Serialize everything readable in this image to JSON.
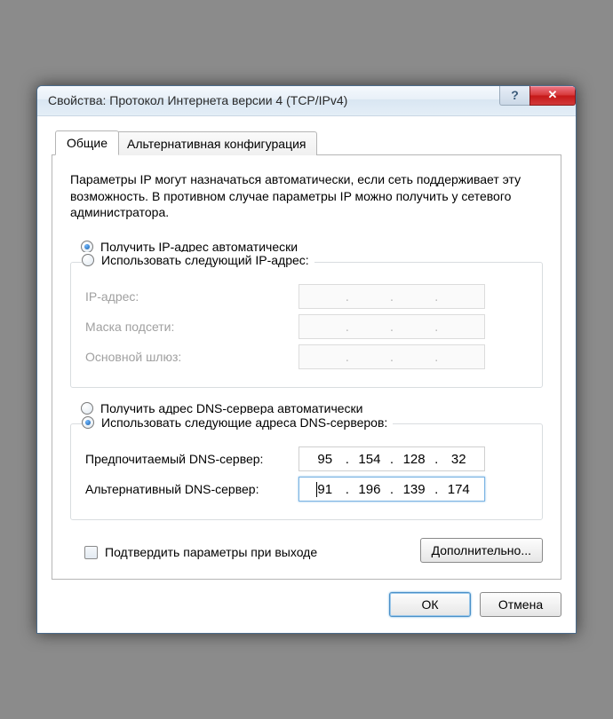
{
  "titlebar": {
    "title": "Свойства: Протокол Интернета версии 4 (TCP/IPv4)",
    "help_glyph": "?",
    "close_glyph": "✕"
  },
  "tabs": {
    "general": "Общие",
    "alternate": "Альтернативная конфигурация"
  },
  "intro": "Параметры IP могут назначаться автоматически, если сеть поддерживает эту возможность. В противном случае параметры IP можно получить у сетевого администратора.",
  "ip_section": {
    "auto_label": "Получить IP-адрес автоматически",
    "manual_label": "Использовать следующий IP-адрес:",
    "ip_label": "IP-адрес:",
    "mask_label": "Маска подсети:",
    "gateway_label": "Основной шлюз:",
    "ip_value": [
      "",
      "",
      "",
      ""
    ],
    "mask_value": [
      "",
      "",
      "",
      ""
    ],
    "gateway_value": [
      "",
      "",
      "",
      ""
    ],
    "selected": "auto"
  },
  "dns_section": {
    "auto_label": "Получить адрес DNS-сервера автоматически",
    "manual_label": "Использовать следующие адреса DNS-серверов:",
    "preferred_label": "Предпочитаемый DNS-сервер:",
    "alternate_label": "Альтернативный DNS-сервер:",
    "preferred_value": [
      "95",
      "154",
      "128",
      "32"
    ],
    "alternate_value": [
      "91",
      "196",
      "139",
      "174"
    ],
    "selected": "manual"
  },
  "validate_checkbox": {
    "label": "Подтвердить параметры при выходе",
    "checked": false
  },
  "buttons": {
    "advanced": "Дополнительно...",
    "ok": "ОК",
    "cancel": "Отмена"
  }
}
